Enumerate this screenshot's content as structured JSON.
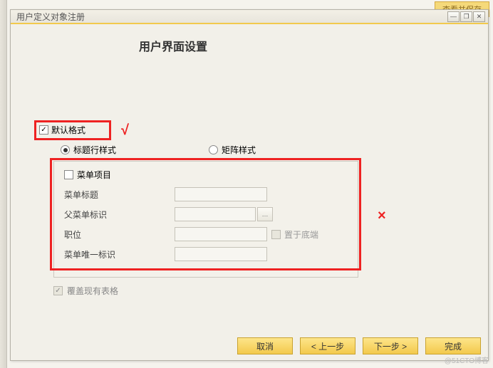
{
  "bg_tab": "查看并保存",
  "window_title": "用户定义对象注册",
  "titlebar_buttons": {
    "minimize": "—",
    "restore": "❐",
    "close": "✕"
  },
  "section_title": "用户界面设置",
  "default_format": {
    "label": "默认格式",
    "checked": true
  },
  "annotation_check": "√",
  "annotation_x": "×",
  "style_options": {
    "title_row": {
      "label": "标题行样式",
      "selected": true
    },
    "matrix": {
      "label": "矩阵样式",
      "selected": false
    }
  },
  "menu_item_checkbox": {
    "label": "菜单项目",
    "checked": false
  },
  "fields": {
    "menu_title": {
      "label": "菜单标题",
      "value": ""
    },
    "parent_menu_id": {
      "label": "父菜单标识",
      "value": "",
      "has_button": true
    },
    "position": {
      "label": "职位",
      "value": "",
      "trailing_checkbox_label": "置于底端",
      "trailing_checked": false
    },
    "menu_unique_id": {
      "label": "菜单唯一标识",
      "value": ""
    }
  },
  "cover_existing": {
    "label": "覆盖现有表格",
    "checked": true,
    "disabled": true
  },
  "buttons": {
    "cancel": "取消",
    "prev": "< 上一步",
    "next": "下一步 >",
    "finish": "完成"
  },
  "watermark": "@51CTO博客"
}
